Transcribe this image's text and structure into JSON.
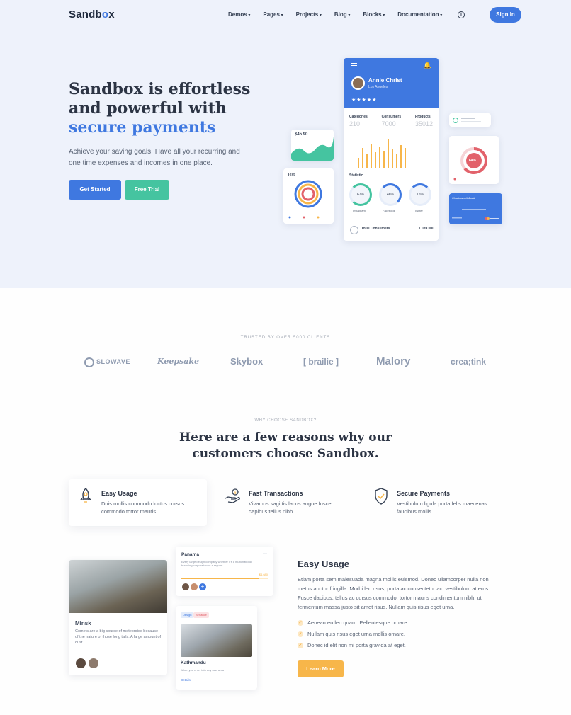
{
  "brand": {
    "name_pre": "Sandb",
    "name_o": "o",
    "name_post": "x"
  },
  "nav": {
    "items": [
      "Demos",
      "Pages",
      "Projects",
      "Blog",
      "Blocks",
      "Documentation"
    ],
    "info_icon": "info-circle-icon",
    "signin_label": "Sign In"
  },
  "hero": {
    "title_line1": "Sandbox is effortless",
    "title_line2": "and powerful with",
    "title_accent": "secure payments",
    "subtitle": "Achieve your saving goals. Have all your recurring and one time expenses and incomes in one place.",
    "primary_button": "Get Started",
    "secondary_button": "Free Trial"
  },
  "mockup": {
    "profile_name": "Annie Christ",
    "profile_location": "Los Angeles",
    "stars": "★★★★★",
    "stats": [
      {
        "label": "Categories",
        "value": "210"
      },
      {
        "label": "Consumers",
        "value": "7000"
      },
      {
        "label": "Products",
        "value": "35012"
      }
    ],
    "bar_values": [
      0.35,
      0.7,
      0.5,
      0.85,
      0.55,
      0.75,
      0.6,
      1.0,
      0.65,
      0.5,
      0.8,
      0.7
    ],
    "statistic_title": "Statistic",
    "rings": [
      {
        "value": "67%",
        "label": "Instagram"
      },
      {
        "value": "46%",
        "label": "Facebook"
      },
      {
        "value": "15%",
        "label": "Twitter"
      }
    ],
    "total_label": "Total Consumers",
    "total_value": "1.039.000",
    "price": "$45.90",
    "text_card_title": "Text",
    "donut_value": "64%",
    "bank_title": "CharlesworthBank"
  },
  "clients": {
    "heading": "TRUSTED BY OVER 5000 CLIENTS",
    "logos": [
      "SLOWAVE",
      "Keepsake",
      "Skybox",
      "[ brailie ]",
      "Malory",
      "crea;tink"
    ]
  },
  "why": {
    "kicker": "WHY CHOOSE SANDBOX?",
    "title_line1": "Here are a few reasons why our",
    "title_line2": "customers choose Sandbox.",
    "features": [
      {
        "icon": "rocket-icon",
        "title": "Easy Usage",
        "text": "Duis mollis commodo luctus cursus commodo tortor mauris."
      },
      {
        "icon": "hand-coin-icon",
        "title": "Fast Transactions",
        "text": "Vivamus sagittis lacus augue fusce dapibus tellus nibh."
      },
      {
        "icon": "shield-check-icon",
        "title": "Secure Payments",
        "text": "Vestibulum ligula porta felis maecenas faucibus mollis."
      }
    ]
  },
  "showcase": {
    "minsk": {
      "title": "Minsk",
      "text": "Comets are a big source of meteoroids because of the nature of those long tails. A large amount of dust."
    },
    "panama": {
      "title": "Panama",
      "text": "Every large design company whether it's a multi-national branding corporation or a regular",
      "progress_label": "$4.680",
      "progress": 0.9
    },
    "kathmandu": {
      "title": "Kathmandu",
      "text": "When you enter into any new area",
      "link": "Details",
      "tags": [
        "Design",
        "Behance"
      ]
    },
    "heading": "Easy Usage",
    "paragraph": "Etiam porta sem malesuada magna mollis euismod. Donec ullamcorper nulla non metus auctor fringilla. Morbi leo risus, porta ac consectetur ac, vestibulum at eros. Fusce dapibus, tellus ac cursus commodo, tortor mauris condimentum nibh, ut fermentum massa justo sit amet risus. Nullam quis risus eget urna.",
    "bullets": [
      "Aenean eu leo quam. Pellentesque ornare.",
      "Nullam quis risus eget urna mollis ornare.",
      "Donec id elit non mi porta gravida at eget."
    ],
    "button": "Learn More"
  },
  "colors": {
    "primary": "#3f78e0",
    "green": "#45c4a0",
    "yellow": "#f7b64a",
    "hero_bg": "#eef2fb",
    "heading": "#2c3444"
  }
}
